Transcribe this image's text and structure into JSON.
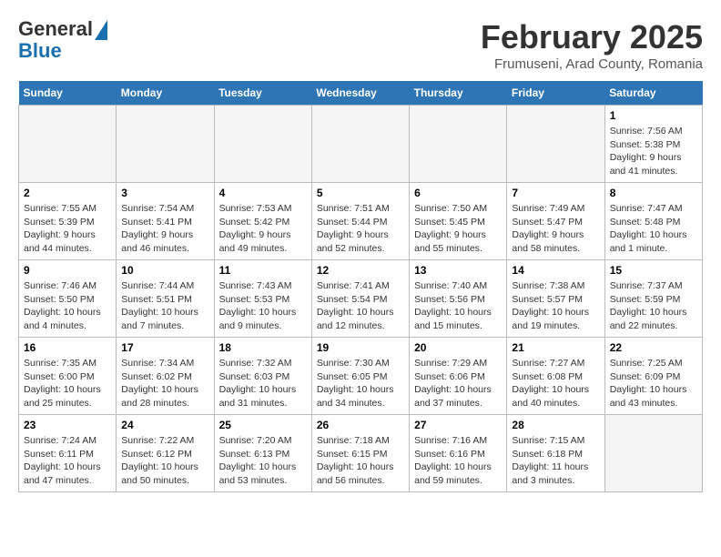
{
  "header": {
    "logo_line1": "General",
    "logo_line2": "Blue",
    "month": "February 2025",
    "location": "Frumuseni, Arad County, Romania"
  },
  "weekdays": [
    "Sunday",
    "Monday",
    "Tuesday",
    "Wednesday",
    "Thursday",
    "Friday",
    "Saturday"
  ],
  "weeks": [
    [
      {
        "day": "",
        "info": ""
      },
      {
        "day": "",
        "info": ""
      },
      {
        "day": "",
        "info": ""
      },
      {
        "day": "",
        "info": ""
      },
      {
        "day": "",
        "info": ""
      },
      {
        "day": "",
        "info": ""
      },
      {
        "day": "1",
        "info": "Sunrise: 7:56 AM\nSunset: 5:38 PM\nDaylight: 9 hours and 41 minutes."
      }
    ],
    [
      {
        "day": "2",
        "info": "Sunrise: 7:55 AM\nSunset: 5:39 PM\nDaylight: 9 hours and 44 minutes."
      },
      {
        "day": "3",
        "info": "Sunrise: 7:54 AM\nSunset: 5:41 PM\nDaylight: 9 hours and 46 minutes."
      },
      {
        "day": "4",
        "info": "Sunrise: 7:53 AM\nSunset: 5:42 PM\nDaylight: 9 hours and 49 minutes."
      },
      {
        "day": "5",
        "info": "Sunrise: 7:51 AM\nSunset: 5:44 PM\nDaylight: 9 hours and 52 minutes."
      },
      {
        "day": "6",
        "info": "Sunrise: 7:50 AM\nSunset: 5:45 PM\nDaylight: 9 hours and 55 minutes."
      },
      {
        "day": "7",
        "info": "Sunrise: 7:49 AM\nSunset: 5:47 PM\nDaylight: 9 hours and 58 minutes."
      },
      {
        "day": "8",
        "info": "Sunrise: 7:47 AM\nSunset: 5:48 PM\nDaylight: 10 hours and 1 minute."
      }
    ],
    [
      {
        "day": "9",
        "info": "Sunrise: 7:46 AM\nSunset: 5:50 PM\nDaylight: 10 hours and 4 minutes."
      },
      {
        "day": "10",
        "info": "Sunrise: 7:44 AM\nSunset: 5:51 PM\nDaylight: 10 hours and 7 minutes."
      },
      {
        "day": "11",
        "info": "Sunrise: 7:43 AM\nSunset: 5:53 PM\nDaylight: 10 hours and 9 minutes."
      },
      {
        "day": "12",
        "info": "Sunrise: 7:41 AM\nSunset: 5:54 PM\nDaylight: 10 hours and 12 minutes."
      },
      {
        "day": "13",
        "info": "Sunrise: 7:40 AM\nSunset: 5:56 PM\nDaylight: 10 hours and 15 minutes."
      },
      {
        "day": "14",
        "info": "Sunrise: 7:38 AM\nSunset: 5:57 PM\nDaylight: 10 hours and 19 minutes."
      },
      {
        "day": "15",
        "info": "Sunrise: 7:37 AM\nSunset: 5:59 PM\nDaylight: 10 hours and 22 minutes."
      }
    ],
    [
      {
        "day": "16",
        "info": "Sunrise: 7:35 AM\nSunset: 6:00 PM\nDaylight: 10 hours and 25 minutes."
      },
      {
        "day": "17",
        "info": "Sunrise: 7:34 AM\nSunset: 6:02 PM\nDaylight: 10 hours and 28 minutes."
      },
      {
        "day": "18",
        "info": "Sunrise: 7:32 AM\nSunset: 6:03 PM\nDaylight: 10 hours and 31 minutes."
      },
      {
        "day": "19",
        "info": "Sunrise: 7:30 AM\nSunset: 6:05 PM\nDaylight: 10 hours and 34 minutes."
      },
      {
        "day": "20",
        "info": "Sunrise: 7:29 AM\nSunset: 6:06 PM\nDaylight: 10 hours and 37 minutes."
      },
      {
        "day": "21",
        "info": "Sunrise: 7:27 AM\nSunset: 6:08 PM\nDaylight: 10 hours and 40 minutes."
      },
      {
        "day": "22",
        "info": "Sunrise: 7:25 AM\nSunset: 6:09 PM\nDaylight: 10 hours and 43 minutes."
      }
    ],
    [
      {
        "day": "23",
        "info": "Sunrise: 7:24 AM\nSunset: 6:11 PM\nDaylight: 10 hours and 47 minutes."
      },
      {
        "day": "24",
        "info": "Sunrise: 7:22 AM\nSunset: 6:12 PM\nDaylight: 10 hours and 50 minutes."
      },
      {
        "day": "25",
        "info": "Sunrise: 7:20 AM\nSunset: 6:13 PM\nDaylight: 10 hours and 53 minutes."
      },
      {
        "day": "26",
        "info": "Sunrise: 7:18 AM\nSunset: 6:15 PM\nDaylight: 10 hours and 56 minutes."
      },
      {
        "day": "27",
        "info": "Sunrise: 7:16 AM\nSunset: 6:16 PM\nDaylight: 10 hours and 59 minutes."
      },
      {
        "day": "28",
        "info": "Sunrise: 7:15 AM\nSunset: 6:18 PM\nDaylight: 11 hours and 3 minutes."
      },
      {
        "day": "",
        "info": ""
      }
    ]
  ]
}
